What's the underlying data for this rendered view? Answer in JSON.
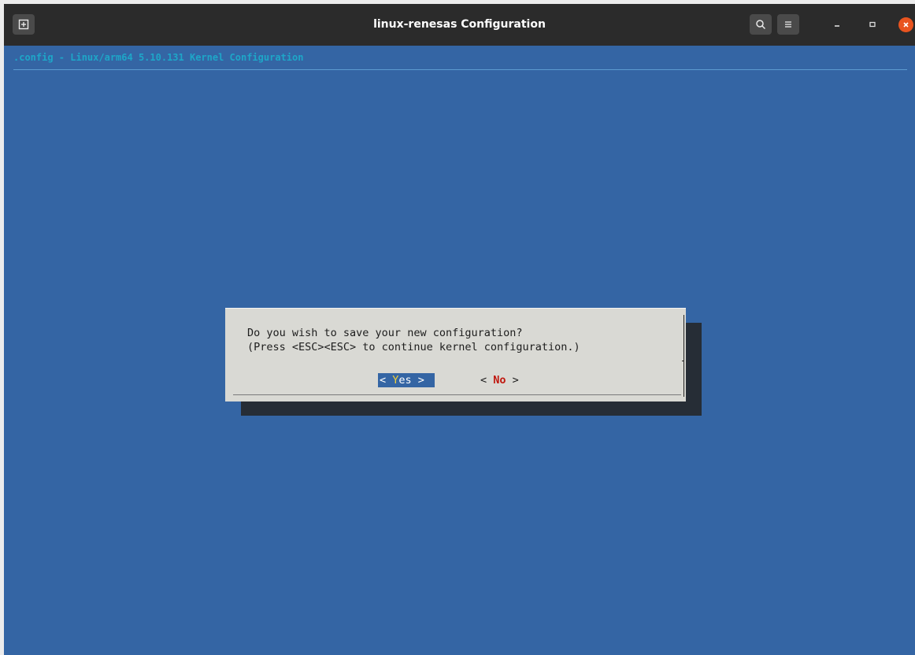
{
  "window": {
    "title": "linux-renesas Configuration",
    "icons": [
      "new-tab-icon",
      "search-icon",
      "hamburger-menu-icon",
      "minimize-icon",
      "maximize-icon",
      "close-icon"
    ]
  },
  "terminal": {
    "backtitle": ".config - Linux/arm64 5.10.131 Kernel Configuration"
  },
  "dialog": {
    "line1": "Do you wish to save your new configuration?",
    "line2": "(Press <ESC><ESC> to continue kernel configuration.)",
    "yes": {
      "left": "< ",
      "hotkey": "Y",
      "rest": "es >"
    },
    "no": {
      "left": "< ",
      "hotkey": "No",
      "rest": " >"
    },
    "selected": "yes"
  },
  "colors": {
    "terminal_bg": "#3465a4",
    "titlebar_bg": "#2b2b2b",
    "dialog_bg": "#d9d9d4",
    "close_button": "#e9541f"
  }
}
